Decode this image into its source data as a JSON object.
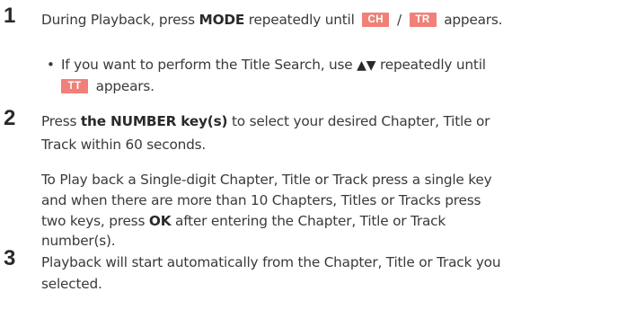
{
  "steps": [
    {
      "number": "1",
      "text_before": "During Playback, press ",
      "key": "MODE",
      "text_mid": " repeatedly until ",
      "badge1": "CH",
      "separator": " / ",
      "badge2": "TR",
      "text_after": " appears."
    },
    {
      "number": "2",
      "text_before": "Press ",
      "key": "the NUMBER key(s)",
      "line1_after": " to select your desired Chapter, Title or",
      "line2": "Track within 60 seconds."
    },
    {
      "number": "3",
      "line1": "Playback will start automatically from the Chapter, Title or Track you",
      "line2": "selected."
    }
  ],
  "bullet": {
    "symbol": "•",
    "text_before": "If you want to perform the Title Search, use ",
    "up_arrow": "▲",
    "down_arrow": "▼",
    "text_after": " repeatedly until",
    "badge": "TT",
    "line2_after": " appears."
  },
  "paragraph": {
    "line1": "To Play back a Single-digit Chapter, Title or Track press a single key",
    "line2": "and when there are more than 10 Chapters, Titles or Tracks press",
    "line3_before": "two keys, press ",
    "line3_key": "OK",
    "line3_after": " after entering the Chapter, Title or Track",
    "line4": "number(s)."
  },
  "colors": {
    "badge": "#f08078",
    "text": "#3a3a3a"
  }
}
